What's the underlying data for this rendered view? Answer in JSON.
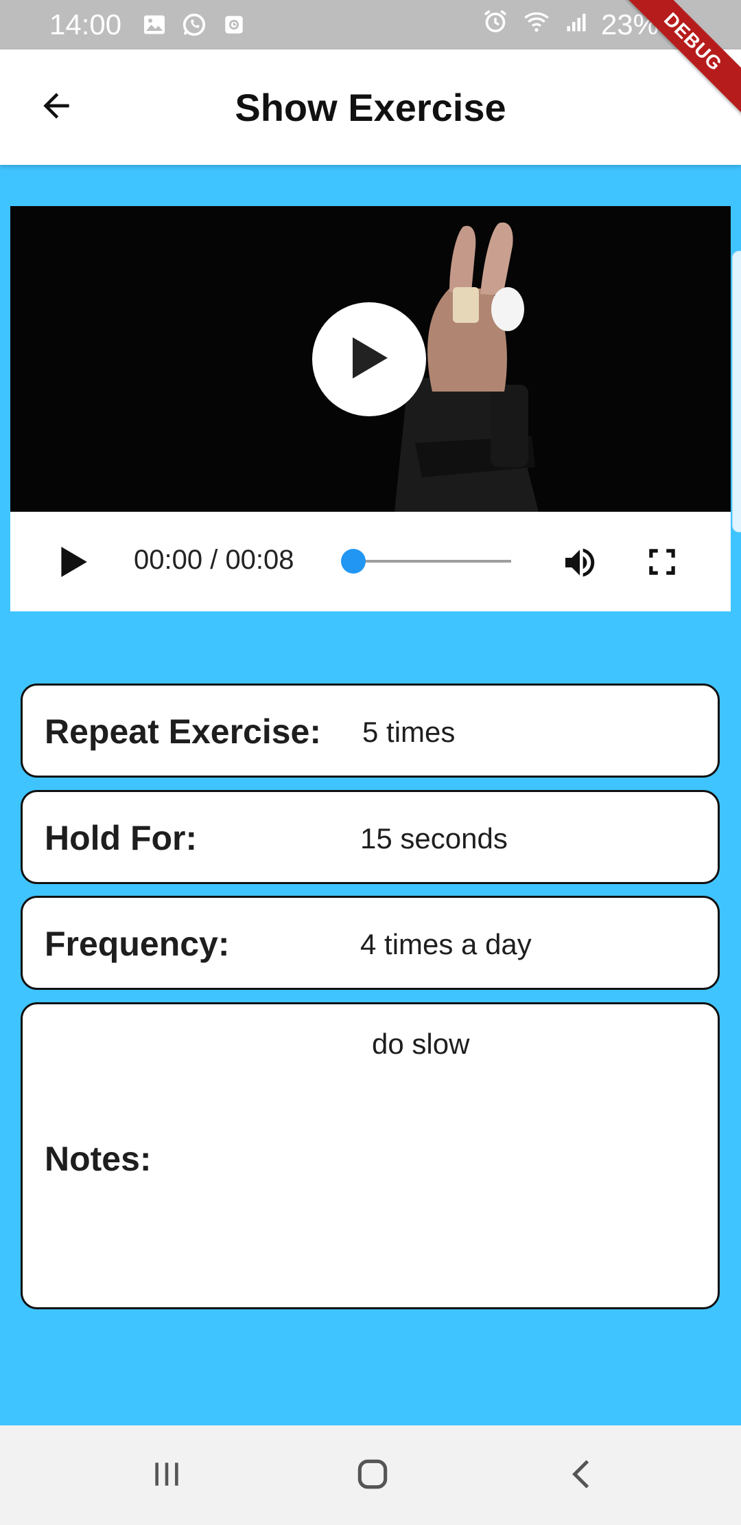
{
  "status_bar": {
    "time": "14:00",
    "left_icons": [
      "image-icon",
      "whatsapp-icon",
      "calendar-icon"
    ],
    "right_icons": [
      "alarm-icon",
      "wifi-icon",
      "signal-icon"
    ],
    "battery": "23%"
  },
  "debug_banner": "DEBUG",
  "app_bar": {
    "title": "Show Exercise",
    "back_icon": "arrow-back-icon"
  },
  "video": {
    "time_display": "00:00 / 00:08",
    "progress": 0.0,
    "accent_color": "#2196f3"
  },
  "details": {
    "repeat": {
      "label": "Repeat Exercise:",
      "value": "5 times"
    },
    "hold": {
      "label": "Hold For:",
      "value": "15 seconds"
    },
    "frequency": {
      "label": "Frequency:",
      "value": "4 times a day"
    },
    "notes": {
      "label": "Notes:",
      "value": "do slow"
    }
  },
  "colors": {
    "background": "#40c4ff",
    "app_bar": "#ffffff",
    "card_border": "#111111"
  },
  "nav_bar": {
    "icons": [
      "recent-apps-icon",
      "home-icon",
      "back-icon"
    ]
  }
}
